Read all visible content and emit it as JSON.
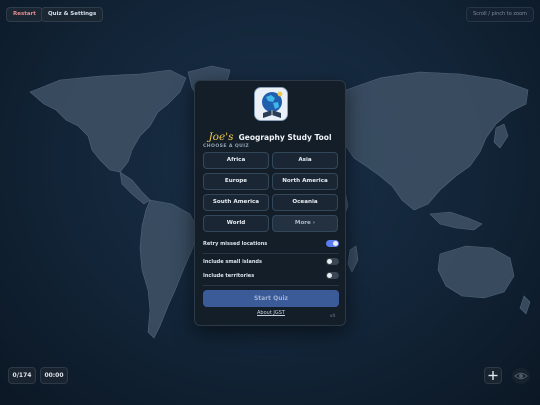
{
  "toolbar": {
    "restart_label": "Restart",
    "quiz_settings_label": "Quiz & Settings",
    "zoom_hint": "Scroll / pinch to zoom"
  },
  "panel": {
    "title_prefix": "Joe's",
    "title_rest": "Geography Study Tool",
    "choose_label": "CHOOSE A QUIZ",
    "quizzes": [
      "Africa",
      "Asia",
      "Europe",
      "North America",
      "South America",
      "Oceania",
      "World",
      "More ›"
    ],
    "options": [
      {
        "label": "Retry missed locations",
        "on": true
      },
      {
        "label": "Include small islands",
        "on": false
      },
      {
        "label": "Include territories",
        "on": false
      }
    ],
    "start_label": "Start Quiz",
    "about_label": "About JGST",
    "version": "v4"
  },
  "status": {
    "score": "0/174",
    "timer": "00:00"
  },
  "colors": {
    "accent": "#5b7cf0",
    "background": "#0f1e2e",
    "panel": "#141e29",
    "restart_text": "#e58b8b",
    "title_accent": "#f1c84a"
  },
  "icons": {
    "logo": "globe-logo-icon",
    "locate": "crosshair-icon",
    "visibility": "eye-icon"
  }
}
